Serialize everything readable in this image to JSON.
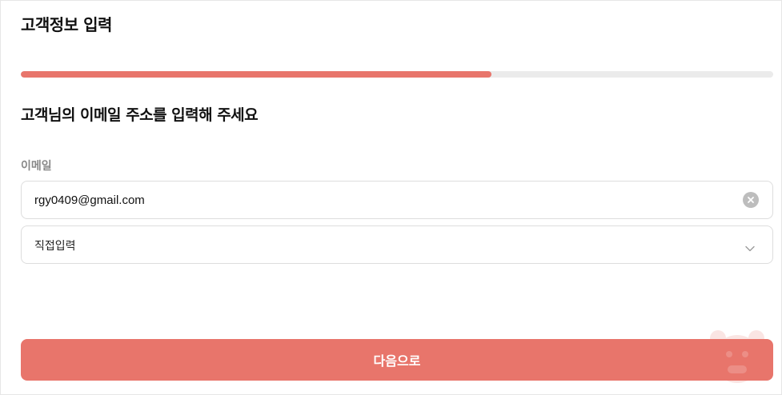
{
  "header": {
    "title": "고객정보 입력"
  },
  "progress": {
    "fraction": 0.625
  },
  "main": {
    "question": "고객님의 이메일 주소를 입력해 주세요",
    "email_label": "이메일",
    "email_value": "rgy0409@gmail.com",
    "domain_select_value": "직접입력"
  },
  "footer": {
    "next_label": "다음으로"
  },
  "icons": {
    "clear": "clear-icon",
    "chevron": "chevron-down-icon",
    "mascot": "mascot-icon"
  },
  "colors": {
    "accent": "#e8756b",
    "track": "#ebebeb",
    "clear_icon": "#bdbdbd"
  }
}
